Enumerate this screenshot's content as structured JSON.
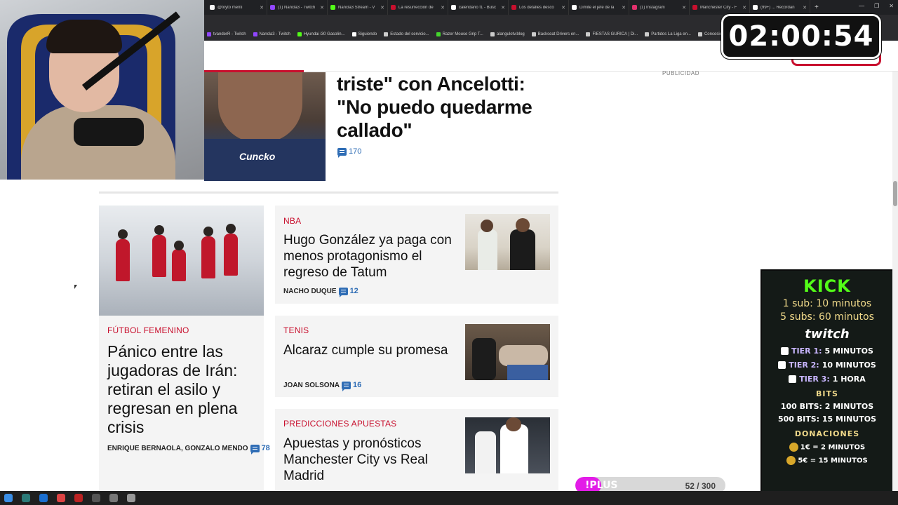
{
  "browser": {
    "tabs": [
      {
        "title": "@toyto menti",
        "color": "#f5f5f5"
      },
      {
        "title": "(1) Nancla3 - Twitch",
        "color": "#9146ff"
      },
      {
        "title": "Nancla3 Stream - V",
        "color": "#53fc18"
      },
      {
        "title": "La resurrección de",
        "color": "#c8102e"
      },
      {
        "title": "calendario f1 - Busc",
        "color": "#ffffff"
      },
      {
        "title": "Los detalles desco",
        "color": "#c8102e"
      },
      {
        "title": "Dimite el jefe de la",
        "color": "#ffffff"
      },
      {
        "title": "(1) Instagram",
        "color": "#e1306c"
      },
      {
        "title": "Manchester City - F",
        "color": "#c8102e"
      },
      {
        "title": "(99+) ... Recordan",
        "color": "#ffffff"
      }
    ],
    "new_tab": "+",
    "bookmarks": [
      {
        "label": "tvanderR - Twitch",
        "color": "#9146ff"
      },
      {
        "label": "Nancla3 - Twitch",
        "color": "#9146ff"
      },
      {
        "label": "Hyundai i30 Gasolin...",
        "color": "#53fc18"
      },
      {
        "label": "Siguiendo",
        "color": "#ffffff"
      },
      {
        "label": "Estado del servicio...",
        "color": "#cccccc"
      },
      {
        "label": "Razer Mouse Grip T...",
        "color": "#44d62c"
      },
      {
        "label": "alangulotv.blog",
        "color": "#cccccc"
      },
      {
        "label": "Backseat Drivers en...",
        "color": "#cccccc"
      },
      {
        "label": "FIESTAS GURICA | Di...",
        "color": "#cccccc"
      },
      {
        "label": "Partidos La Liga en...",
        "color": "#cccccc"
      },
      {
        "label": "Concesion...",
        "color": "#cccccc"
      }
    ]
  },
  "timer": "02:00:54",
  "hero": {
    "title": "triste\" con Ancelotti: \"No puedo quedarme callado\"",
    "comments": "170",
    "sponsor": "Cuncko"
  },
  "publicidad": "PUBLICIDAD",
  "big_card": {
    "kicker": "FÚTBOL FEMENINO",
    "title": "Pánico entre las jugadoras de Irán: retiran el asilo y regresan en plena crisis",
    "authors": "ENRIQUE BERNAOLA, GONZALO MENDO",
    "comments": "78"
  },
  "cards": [
    {
      "kicker": "NBA",
      "title": "Hugo González ya paga con menos protagonismo el regreso de Tatum",
      "author": "NACHO DUQUE",
      "comments": "12"
    },
    {
      "kicker": "TENIS",
      "title": "Alcaraz cumple su promesa",
      "author": "JOAN SOLSONA",
      "comments": "16"
    },
    {
      "kicker": "PREDICCIONES APUESTAS",
      "title": "Apuestas y pronósticos Manchester City vs Real Madrid",
      "author": "",
      "comments": ""
    }
  ],
  "kick_panel": {
    "logo": "KICK",
    "sub1": "1 sub: 10 minutos",
    "sub5": "5 subs: 60 minutos",
    "twitch_logo": "twitch",
    "tiers": [
      {
        "label": "TIER 1:",
        "value": "5 MINUTOS"
      },
      {
        "label": "TIER 2:",
        "value": "10 MINUTOS"
      },
      {
        "label": "TIER 3:",
        "value": "1 HORA"
      }
    ],
    "bits_title": "BITS",
    "bits": [
      "100 BITS: 2 MINUTOS",
      "500 BITS: 15 MINUTOS"
    ],
    "donations_title": "DONACIONES",
    "donations": [
      "1€ = 2 MINUTOS",
      "5€ = 15 MINUTOS"
    ]
  },
  "plus_bar": {
    "label": "!PLUS",
    "count": "52 / 300",
    "progress": 0.173,
    "color": "#e31ce8"
  },
  "colors": {
    "accent": "#c8102e",
    "comment_blue": "#2f6db5",
    "kick_green": "#53fc18"
  }
}
